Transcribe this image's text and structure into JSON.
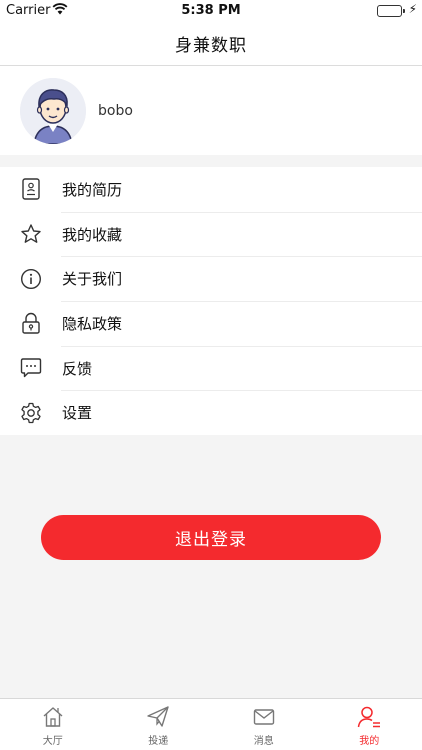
{
  "status_bar": {
    "carrier": "Carrier",
    "time": "5:38 PM"
  },
  "header": {
    "title": "身兼数职"
  },
  "profile": {
    "username": "bobo"
  },
  "menu": {
    "items": [
      {
        "label": "我的简历",
        "icon": "resume-icon"
      },
      {
        "label": "我的收藏",
        "icon": "star-icon"
      },
      {
        "label": "关于我们",
        "icon": "info-icon"
      },
      {
        "label": "隐私政策",
        "icon": "lock-icon"
      },
      {
        "label": "反馈",
        "icon": "feedback-icon"
      },
      {
        "label": "设置",
        "icon": "gear-icon"
      }
    ]
  },
  "logout": {
    "label": "退出登录"
  },
  "tabs": [
    {
      "label": "大厅",
      "icon": "home-icon"
    },
    {
      "label": "投递",
      "icon": "paper-plane-icon"
    },
    {
      "label": "消息",
      "icon": "mail-icon"
    },
    {
      "label": "我的",
      "icon": "profile-icon",
      "active": true
    }
  ],
  "colors": {
    "accent": "#f42a2e",
    "battery": "#2fbf3a"
  }
}
